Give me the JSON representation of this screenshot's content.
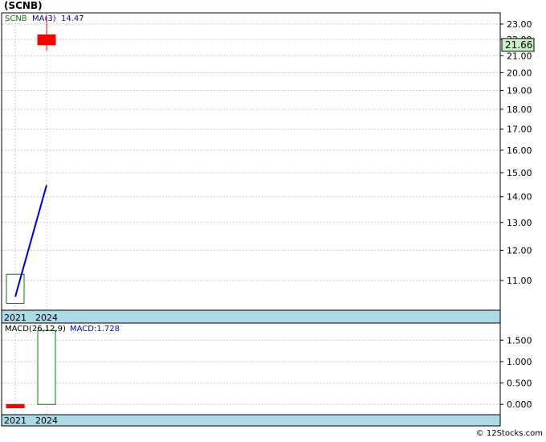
{
  "title": "(SCNB)",
  "footer": "© 12Stocks.com",
  "colors": {
    "background": "#ffffff",
    "frame": "#000000",
    "grid": "#c8c8c8",
    "axis_band": "#add8e6",
    "up": "#008000",
    "down": "#ff0000",
    "ma": "#0000cc",
    "price_tag_bg": "#c8f0c8"
  },
  "chart_data": [
    {
      "type": "candlestick",
      "legend": {
        "symbol": "SCNB",
        "ma_label": "MA(3)",
        "ma_value": "14.47"
      },
      "current_price": "21.66",
      "categories": [
        "2021",
        "2024"
      ],
      "candles": [
        {
          "x": "2021",
          "open": 10.3,
          "close": 11.2,
          "high": 11.2,
          "low": 10.3,
          "direction": "up"
        },
        {
          "x": "2024",
          "open": 22.3,
          "close": 21.66,
          "high": 23.5,
          "low": 21.3,
          "direction": "down"
        }
      ],
      "ma": {
        "name": "MA(3)",
        "values": [
          10.5,
          14.47
        ]
      },
      "ylim": [
        10.1,
        23.75
      ],
      "yticks": [
        "11.00",
        "12.00",
        "13.00",
        "14.00",
        "15.00",
        "16.00",
        "17.00",
        "18.00",
        "19.00",
        "20.00",
        "21.00",
        "22.00",
        "23.00"
      ],
      "scale": "log",
      "grid": true
    },
    {
      "type": "bar",
      "legend": {
        "label": "MACD(26,12,9)",
        "value_label": "MACD:1.728"
      },
      "categories": [
        "2021",
        "2024"
      ],
      "values": [
        -0.08,
        1.728
      ],
      "ylim": [
        -0.24,
        1.9
      ],
      "yticks": [
        "0.000",
        "0.500",
        "1.000",
        "1.500"
      ],
      "grid": true
    }
  ]
}
